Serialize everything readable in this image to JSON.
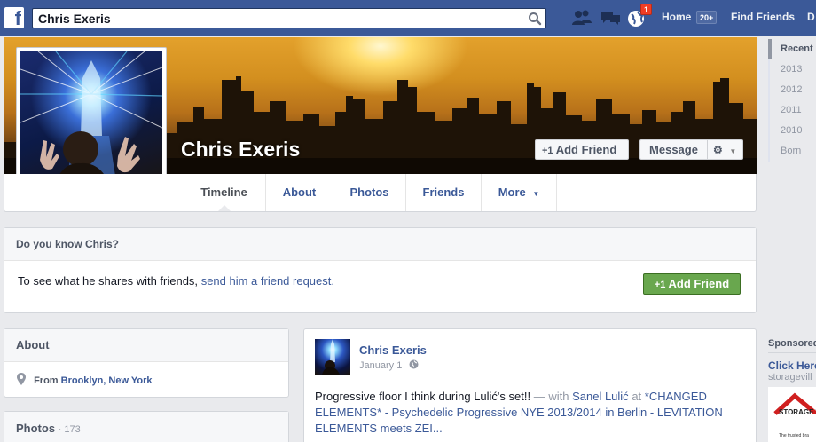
{
  "topbar": {
    "search_value": "Chris Exeris",
    "notifications_count": "1",
    "home_label": "Home",
    "home_count": "20+",
    "find_friends_label": "Find Friends",
    "cut_off_label": "D"
  },
  "profile": {
    "name": "Chris Exeris",
    "add_friend_label": "Add Friend",
    "message_label": "Message"
  },
  "tabs": [
    "Timeline",
    "About",
    "Photos",
    "Friends",
    "More"
  ],
  "rail": [
    "Recent",
    "2013",
    "2012",
    "2011",
    "2010",
    "Born"
  ],
  "know_box": {
    "title": "Do you know Chris?",
    "text": "To see what he shares with friends,",
    "link": "send him a friend request.",
    "button": "Add Friend"
  },
  "about": {
    "title": "About",
    "from_prefix": "From",
    "from_place": "Brooklyn, New York"
  },
  "photos": {
    "title": "Photos",
    "count": "· 173"
  },
  "post": {
    "author": "Chris Exeris",
    "date": "January 1",
    "text_1": "Progressive floor I think during Lulić's set!!",
    "with_sep": "— with",
    "tagged": "Sanel Lulić",
    "at_word": "at",
    "event": "*CHANGED ELEMENTS* - Psychedelic Progressive NYE 2013/2014 in Berlin - LEVITATION ELEMENTS meets ZEI..."
  },
  "sponsored": {
    "title": "Sponsored",
    "link": "Click Here",
    "domain": "storagevill",
    "ad_brand": "STORAGE VILLAGE",
    "ad_tagline": "The trusted bra"
  },
  "colors": {
    "topbar": "#3b5998",
    "link": "#3b5998",
    "green_button": "#69a74e",
    "badge": "#f03d25"
  }
}
